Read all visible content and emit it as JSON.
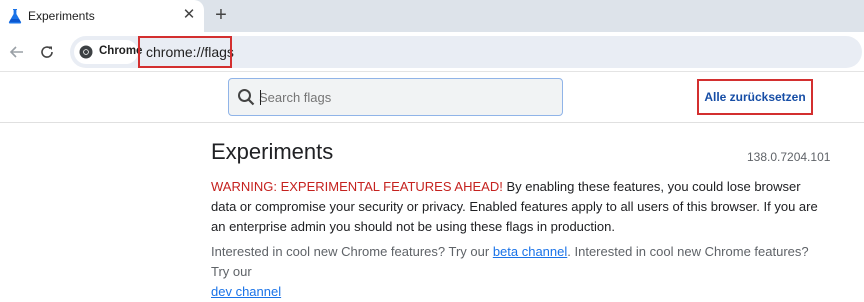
{
  "tab": {
    "title": "Experiments",
    "close_label": "✕",
    "new_tab_label": "+",
    "icon": "flask-icon"
  },
  "toolbar": {
    "back_icon": "arrow-left-icon",
    "reload_icon": "reload-icon",
    "chip_label": "Chrome",
    "url": "chrome://flags"
  },
  "search": {
    "placeholder": "Search flags",
    "icon": "search-icon"
  },
  "reset_button": {
    "label": "Alle zurücksetzen"
  },
  "main": {
    "title": "Experiments",
    "version": "138.0.7204.101",
    "warning_prefix": "WARNING: EXPERIMENTAL FEATURES AHEAD!",
    "warning_body": " By enabling these features, you could lose browser data or compromise your security or privacy. Enabled features apply to all users of this browser. If you are an enterprise admin you should not be using these flags in production.",
    "promo_text_1": "Interested in cool new Chrome features? Try our ",
    "beta_link": "beta channel",
    "promo_text_2": ". Interested in cool new Chrome features? Try our ",
    "dev_link": "dev channel"
  },
  "colors": {
    "highlight_box": "#d32f2f",
    "warning_red": "#c5221f",
    "link_blue": "#1a73e8",
    "button_blue": "#174ea6"
  }
}
